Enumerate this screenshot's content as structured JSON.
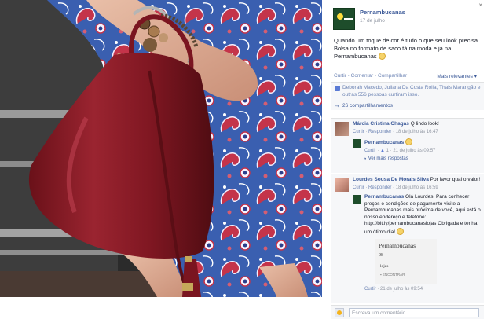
{
  "post": {
    "page_name": "Pernambucanas",
    "date": "17 de julho",
    "text_main": "Quando um toque de cor é tudo o que seu look precisa. Bolsa no formato de saco tá na moda e já na Pernambucanas",
    "close_label": "×"
  },
  "actions": {
    "like": "Curtir",
    "comment": "Comentar",
    "share": "Compartilhar",
    "sep": " · ",
    "relevance": "Mais relevantes ▾"
  },
  "reactions": {
    "likes_text": "Deborah Macedo, Juliana Da Costa Rolla, Thais Marangão e outras 556 pessoas curtiram isso.",
    "shares_text": "26 compartilhamentos"
  },
  "comments": [
    {
      "author": "Márcia Cristina Chagas",
      "text": "Q lindo look!",
      "meta_like": "Curtir",
      "meta_reply": "Responder",
      "meta_time": "18 de julho às 16:47",
      "reply": {
        "author": "Pernambucanas",
        "text": "",
        "meta_like": "Curtir",
        "meta_count": "1",
        "meta_time": "21 de julho às 09:57"
      },
      "more_replies": "↳ Ver mais respostas"
    },
    {
      "author": "Lourdes Sousa De Morais Silva",
      "text": "Por favor qual o valor!",
      "meta_like": "Curtir",
      "meta_reply": "Responder",
      "meta_time": "18 de julho às 16:59",
      "reply": {
        "author": "Pernambucanas",
        "text": "Olá Lourdes! Para conhecer preços e condições de pagamento visite a Pernambucanas mais próxima de você, aqui está o nosso endereço e telefone: http://bit.ly/pernambucanaslojas Obrigada e tenha um ótimo dia!",
        "meta_like": "Curtir",
        "meta_time": "21 de julho às 09:54"
      },
      "preview": {
        "line1": "Pernambucanas",
        "line2": "08",
        "line3": "lojas",
        "line4": "▪ ENCONTRAR"
      }
    }
  ],
  "comment_box": {
    "placeholder": "Escreva um comentário..."
  },
  "colors": {
    "fb_blue": "#3b5998",
    "bag_red": "#8b1a24",
    "dress_blue": "#3a5fb0",
    "dress_red": "#c4344a"
  }
}
